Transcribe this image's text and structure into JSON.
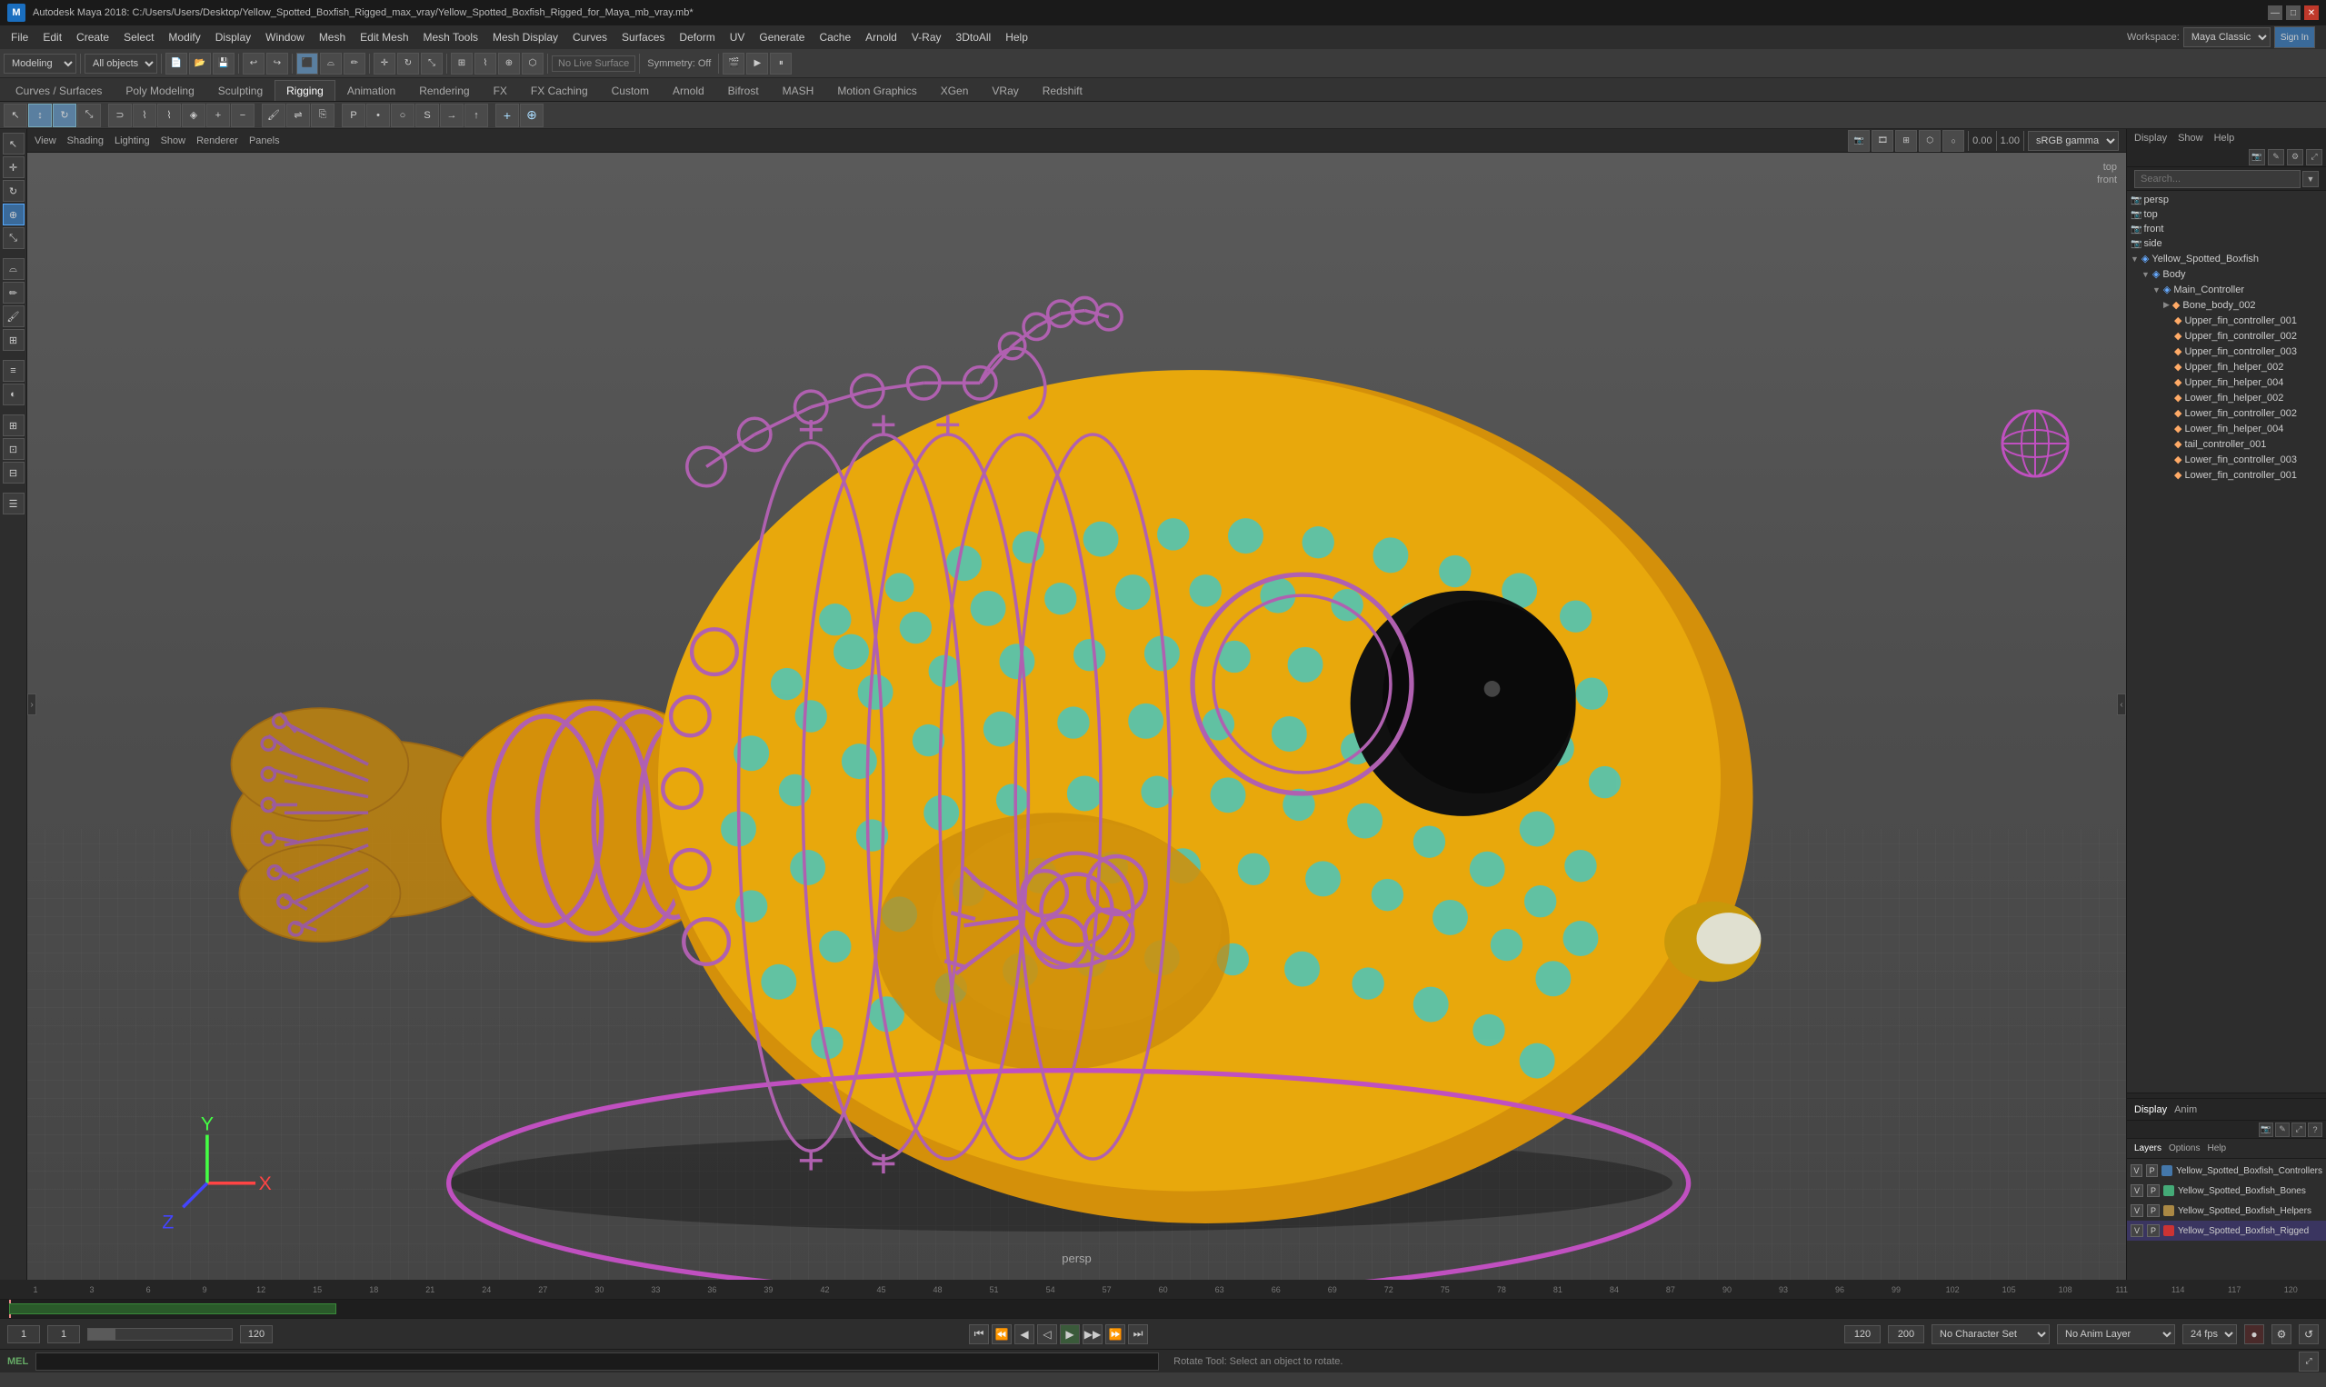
{
  "window": {
    "title": "Autodesk Maya 2018: C:/Users/Users/Desktop/Yellow_Spotted_Boxfish_Rigged_max_vray/Yellow_Spotted_Boxfish_Rigged_for_Maya_mb_vray.mb*"
  },
  "titlebar": {
    "min_label": "—",
    "max_label": "□",
    "close_label": "✕"
  },
  "menubar": {
    "items": [
      "File",
      "Edit",
      "Create",
      "Select",
      "Modify",
      "Display",
      "Window",
      "Mesh",
      "Edit Mesh",
      "Mesh Tools",
      "Mesh Display",
      "Curves",
      "Surfaces",
      "Deform",
      "UV",
      "Generate",
      "Cache",
      "Arnold",
      "V-Ray",
      "3DtoAll",
      "Help"
    ]
  },
  "toolbar": {
    "workspace_label": "Workspace:",
    "workspace_value": "Maya Classic",
    "signin_label": "Sign In",
    "mode_label": "Modeling",
    "objects_label": "All objects",
    "symmetry_label": "Symmetry: Off",
    "no_live_label": "No Live Surface"
  },
  "workflow_tabs": {
    "items": [
      "Curves / Surfaces",
      "Poly Modeling",
      "Sculpting",
      "Rigging",
      "Animation",
      "Rendering",
      "FX",
      "FX Caching",
      "Custom",
      "Arnold",
      "Bifrost",
      "MASH",
      "Motion Graphics",
      "XGen",
      "VRay",
      "Redshift"
    ]
  },
  "active_tab": "Rigging",
  "viewport": {
    "menu_items": [
      "View",
      "Shading",
      "Lighting",
      "Show",
      "Renderer",
      "Panels"
    ],
    "gamma_label": "sRGB gamma",
    "gamma_value": "1.00",
    "zero_label": "0.00",
    "persp_label": "persp",
    "top_label": "top",
    "front_label": "front"
  },
  "right_panel": {
    "header_items": [
      "Display",
      "Show",
      "Help"
    ],
    "search_placeholder": "Search...",
    "outliner_items": [
      {
        "id": "persp",
        "label": "persp",
        "icon": "📷",
        "indent": 0,
        "type": "camera"
      },
      {
        "id": "top",
        "label": "top",
        "icon": "📷",
        "indent": 0,
        "type": "camera"
      },
      {
        "id": "front",
        "label": "front",
        "icon": "📷",
        "indent": 0,
        "type": "camera"
      },
      {
        "id": "side",
        "label": "side",
        "icon": "📷",
        "indent": 0,
        "type": "camera"
      },
      {
        "id": "yellow_spotted",
        "label": "Yellow_Spotted_Boxfish",
        "icon": "▶",
        "indent": 0,
        "type": "group",
        "expanded": true
      },
      {
        "id": "body",
        "label": "Body",
        "icon": "▶",
        "indent": 1,
        "type": "group",
        "expanded": true
      },
      {
        "id": "main_controller",
        "label": "Main_Controller",
        "icon": "▶",
        "indent": 2,
        "type": "group",
        "expanded": true
      },
      {
        "id": "bone_body_002",
        "label": "Bone_body_002",
        "icon": "◆",
        "indent": 3,
        "type": "bone"
      },
      {
        "id": "upper_fin_001",
        "label": "Upper_fin_controller_001",
        "icon": "◆",
        "indent": 4,
        "type": "ctrl"
      },
      {
        "id": "upper_fin_002",
        "label": "Upper_fin_controller_002",
        "icon": "◆",
        "indent": 4,
        "type": "ctrl"
      },
      {
        "id": "upper_fin_003",
        "label": "Upper_fin_controller_003",
        "icon": "◆",
        "indent": 4,
        "type": "ctrl"
      },
      {
        "id": "upper_fin_helper_002",
        "label": "Upper_fin_helper_002",
        "icon": "◆",
        "indent": 4,
        "type": "helper"
      },
      {
        "id": "upper_fin_helper_004",
        "label": "Upper_fin_helper_004",
        "icon": "◆",
        "indent": 4,
        "type": "helper"
      },
      {
        "id": "lower_fin_helper_002",
        "label": "Lower_fin_helper_002",
        "icon": "◆",
        "indent": 4,
        "type": "helper"
      },
      {
        "id": "lower_fin_controller_002",
        "label": "Lower_fin_controller_002",
        "icon": "◆",
        "indent": 4,
        "type": "ctrl"
      },
      {
        "id": "lower_fin_helper_004",
        "label": "Lower_fin_helper_004",
        "icon": "◆",
        "indent": 4,
        "type": "helper"
      },
      {
        "id": "tail_controller_001",
        "label": "tail_controller_001",
        "icon": "◆",
        "indent": 4,
        "type": "ctrl"
      },
      {
        "id": "lower_fin_controller_003",
        "label": "Lower_fin_controller_003",
        "icon": "◆",
        "indent": 4,
        "type": "ctrl"
      },
      {
        "id": "lower_fin_controller_001",
        "label": "Lower_fin_controller_001",
        "icon": "◆",
        "indent": 4,
        "type": "ctrl"
      }
    ]
  },
  "channel_box": {
    "tabs": [
      "Display",
      "Anim"
    ],
    "active_tab": "Display",
    "sub_tabs": [
      "Layers",
      "Options",
      "Help"
    ],
    "layers": [
      {
        "label": "Yellow_Spotted_Boxfish_Controllers",
        "color": "#4477aa",
        "v": "V",
        "p": "P"
      },
      {
        "label": "Yellow_Spotted_Boxfish_Bones",
        "color": "#44aa77",
        "v": "V",
        "p": "P"
      },
      {
        "label": "Yellow_Spotted_Boxfish_Helpers",
        "color": "#aa8844",
        "v": "V",
        "p": "P"
      },
      {
        "label": "Yellow_Spotted_Boxfish_Rigged",
        "color": "#cc3333",
        "v": "V",
        "p": "P",
        "active": true
      }
    ]
  },
  "timeline": {
    "ticks": [
      "1",
      "3",
      "6",
      "9",
      "12",
      "15",
      "18",
      "21",
      "24",
      "27",
      "30",
      "33",
      "36",
      "39",
      "42",
      "45",
      "48",
      "51",
      "54",
      "57",
      "60",
      "63",
      "66",
      "69",
      "72",
      "75",
      "78",
      "81",
      "84",
      "87",
      "90",
      "93",
      "96",
      "99",
      "102",
      "105",
      "108",
      "111",
      "114",
      "117",
      "120"
    ],
    "start_frame": "1",
    "current_frame": "1",
    "end_display": "120",
    "anim_start": "120",
    "anim_end": "200",
    "fps_label": "24 fps",
    "no_char_set": "No Character Set",
    "no_anim_layer": "No Anim Layer"
  },
  "playback": {
    "prev_end": "⏮",
    "prev_key": "⏪",
    "prev_frame": "◀",
    "play_back": "◁",
    "play_fwd": "▶",
    "next_frame": "▶",
    "next_key": "⏩",
    "next_end": "⏭"
  },
  "status_bar": {
    "text": "Rotate Tool: Select an object to rotate."
  },
  "mel_bar": {
    "label": "MEL",
    "placeholder": ""
  }
}
